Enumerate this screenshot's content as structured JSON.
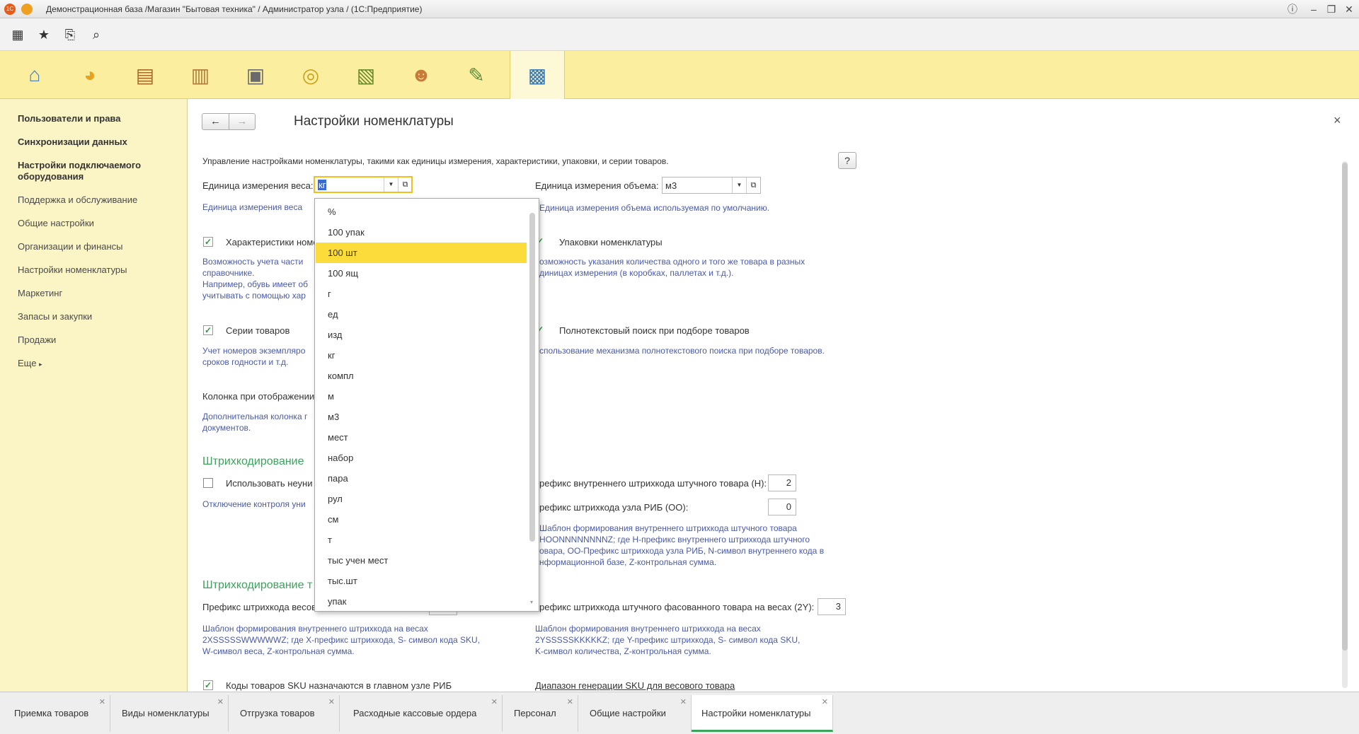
{
  "window": {
    "title": "Демонстрационная база /Магазин \"Бытовая техника\" / Администратор узла / (1С:Предприятие)"
  },
  "sidebar": {
    "items": [
      {
        "label": "Пользователи и права"
      },
      {
        "label": "Синхронизации данных"
      },
      {
        "label": "Настройки подключаемого оборудования"
      },
      {
        "label": "Поддержка и обслуживание"
      },
      {
        "label": "Общие настройки"
      },
      {
        "label": "Организации и финансы"
      },
      {
        "label": "Настройки номенклатуры"
      },
      {
        "label": "Маркетинг"
      },
      {
        "label": "Запасы и закупки"
      },
      {
        "label": "Продажи"
      },
      {
        "label": "Еще"
      }
    ]
  },
  "form": {
    "title": "Настройки номенклатуры",
    "description": "Управление настройками номенклатуры, такими как единицы измерения, характеристики, упаковки, и серии товаров.",
    "help": "?",
    "close": "×",
    "weight_unit": {
      "label": "Единица измерения веса:",
      "value": "кг",
      "hint": "Единица измерения веса"
    },
    "volume_unit": {
      "label": "Единица измерения объема:",
      "value": "м3",
      "hint": "Единица измерения объема используемая по умолчанию."
    },
    "characteristics": {
      "label": "Характеристики номе",
      "hint1": "Возможность учета части",
      "hint2": "справочнике.",
      "hint3": "Например, обувь имеет об",
      "hint4": "учитывать с помощью хар"
    },
    "packages": {
      "label": "Упаковки номенклатуры",
      "hint1": "озможность указания количества одного и того же товара в разных",
      "hint2": "диницах измерения (в коробках, паллетах и т.д.)."
    },
    "series": {
      "label": "Серии товаров",
      "hint1": "Учет номеров экземпляро",
      "hint2": "сроков годности и т.д."
    },
    "fulltext": {
      "label": "Полнотекстовый поиск при подборе товаров",
      "hint": "спользование механизма полнотекстового поиска при подборе товаров."
    },
    "column": {
      "label": "Колонка при отображении",
      "hint1": "Дополнительная колонка г",
      "hint2": "документов."
    },
    "barcoding": {
      "header": "Штрихкодирование",
      "nonunique_label": "Использовать неуни",
      "nonunique_hint": "Отключение контроля уни",
      "prefix_piece_label": "рефикс внутреннего штрихкода штучного товара (H):",
      "prefix_piece_value": "2",
      "prefix_node_label": "рефикс штрихкода узла РИБ (OO):",
      "prefix_node_value": "0",
      "tmpl1": "Шаблон формирования внутреннего штрихкода штучного товара",
      "tmpl2": "HOONNNNNNNNZ; где H-префикс внутреннего штрихкода штучного",
      "tmpl3": "овара, OO-Префикс штрихкода узла РИБ, N-символ внутреннего кода в",
      "tmpl4": "нформационной базе, Z-контрольная сумма."
    },
    "weight_barcoding": {
      "header": "Штрихкодирование т",
      "prefix_weight_label": "Префикс штрихкода весов",
      "prefix_packed_label": "рефикс штрихкода штучного фасованного товара на весах (2Y):",
      "prefix_packed_value": "3",
      "left1": "Шаблон формирования внутреннего штрихкода на весах",
      "left2": "2XSSSSSWWWWWZ; где X-префикс штрихкода, S- символ кода SKU,",
      "left3": "W-символ веса, Z-контрольная сумма.",
      "right1": "Шаблон формирования внутреннего штрихкода на весах",
      "right2": "2YSSSSSKKKKKZ; где Y-префикс штрихкода, S- символ кода SKU,",
      "right3": "K-символ количества, Z-контрольная сумма."
    },
    "sku_main": {
      "label": "Коды товаров SKU назначаются в главном узле РИБ"
    },
    "sku_range": {
      "label": "Диапазон генерации SKU для весового товара"
    }
  },
  "dropdown": {
    "items": [
      "%",
      "100 упак",
      "100 шт",
      "100 ящ",
      "г",
      "ед",
      "изд",
      "кг",
      "компл",
      "м",
      "м3",
      "мест",
      "набор",
      "пара",
      "рул",
      "см",
      "т",
      "тыс учен мест",
      "тыс.шт",
      "упак"
    ],
    "selected_index": 2
  },
  "tabs": [
    {
      "label": "Приемка товаров"
    },
    {
      "label": "Виды номенклатуры"
    },
    {
      "label": "Отгрузка товаров"
    },
    {
      "label": "Расходные кассовые ордера"
    },
    {
      "label": "Персонал"
    },
    {
      "label": "Общие настройки"
    },
    {
      "label": "Настройки номенклатуры",
      "active": true
    }
  ],
  "colors": {
    "accent": "#3ca35c",
    "section_bar": "#fbee9e",
    "sidebar": "#fbf5c6",
    "selected": "#fbdc3a",
    "hint": "#4a5aa8"
  }
}
